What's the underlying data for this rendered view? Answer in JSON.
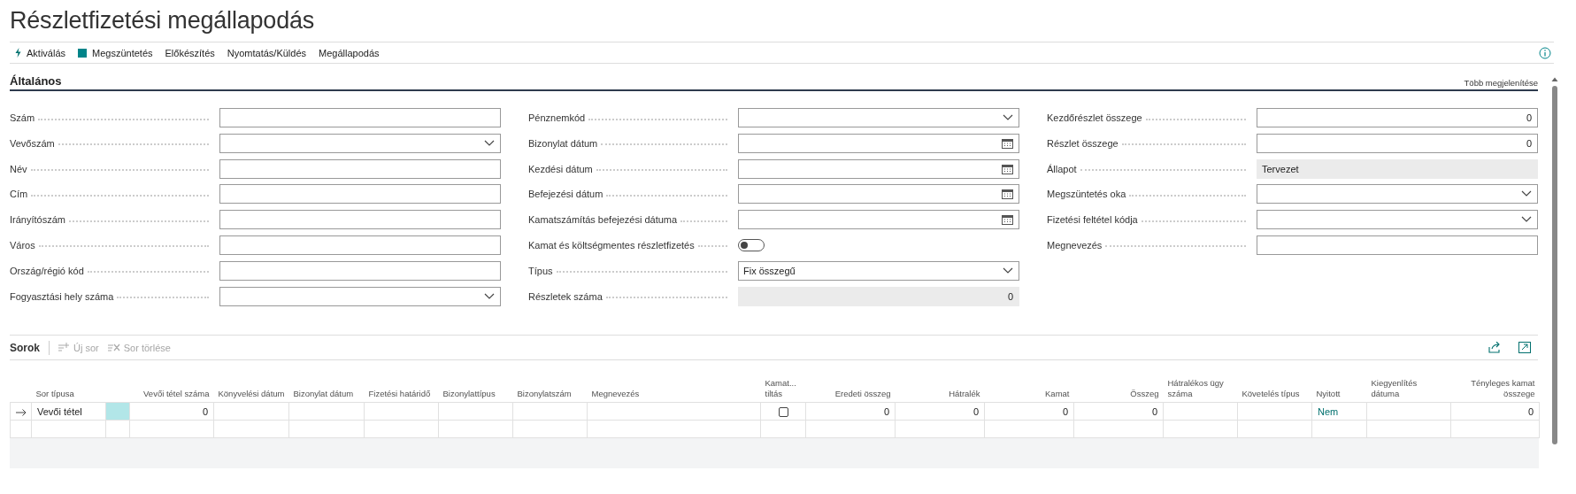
{
  "title": "Részletfizetési megállapodás",
  "actions": [
    {
      "label": "Aktiválás"
    },
    {
      "label": "Megszüntetés"
    },
    {
      "label": "Előkészítés"
    },
    {
      "label": "Nyomtatás/Küldés"
    },
    {
      "label": "Megállapodás"
    }
  ],
  "general": {
    "heading": "Általános",
    "more_link": "Több megjelenítése",
    "columns": [
      [
        {
          "label": "Szám",
          "kind": "text"
        },
        {
          "label": "Vevőszám",
          "kind": "dropdown"
        },
        {
          "label": "Név",
          "kind": "text"
        },
        {
          "label": "Cím",
          "kind": "text"
        },
        {
          "label": "Irányítószám",
          "kind": "text"
        },
        {
          "label": "Város",
          "kind": "text"
        },
        {
          "label": "Ország/régió kód",
          "kind": "text"
        },
        {
          "label": "Fogyasztási hely száma",
          "kind": "dropdown"
        }
      ],
      [
        {
          "label": "Pénznemkód",
          "kind": "dropdown"
        },
        {
          "label": "Bizonylat dátum",
          "kind": "date"
        },
        {
          "label": "Kezdési dátum",
          "kind": "date"
        },
        {
          "label": "Befejezési dátum",
          "kind": "date"
        },
        {
          "label": "Kamatszámítás befejezési dátuma",
          "kind": "date"
        },
        {
          "label": "Kamat és költségmentes részletfizetés",
          "kind": "toggle",
          "on": false
        },
        {
          "label": "Típus",
          "kind": "dropdown",
          "value": "Fix összegű"
        },
        {
          "label": "Részletek száma",
          "kind": "readonly_number",
          "value": "0"
        }
      ],
      [
        {
          "label": "Kezdőrészlet összege",
          "kind": "number",
          "value": "0"
        },
        {
          "label": "Részlet összege",
          "kind": "number",
          "value": "0"
        },
        {
          "label": "Állapot",
          "kind": "readonly",
          "value": "Tervezet"
        },
        {
          "label": "Megszüntetés oka",
          "kind": "dropdown"
        },
        {
          "label": "Fizetési feltétel kódja",
          "kind": "dropdown"
        },
        {
          "label": "Megnevezés",
          "kind": "text"
        }
      ]
    ]
  },
  "lines": {
    "heading": "Sorok",
    "actions": [
      {
        "label": "Új sor",
        "disabled": true
      },
      {
        "label": "Sor törlése",
        "disabled": true
      }
    ],
    "columns": [
      {
        "label": "Sor típusa",
        "kind": "text"
      },
      {
        "label": "Vevői tétel száma",
        "kind": "number"
      },
      {
        "label": "Könyvelési dátum",
        "kind": "text"
      },
      {
        "label": "Bizonylat dátum",
        "kind": "text"
      },
      {
        "label": "Fizetési határidő",
        "kind": "text"
      },
      {
        "label": "Bizonylattípus",
        "kind": "text"
      },
      {
        "label": "Bizonylatszám",
        "kind": "text"
      },
      {
        "label": "Megnevezés",
        "kind": "text"
      },
      {
        "label": "Kamat... tiltás",
        "kind": "check"
      },
      {
        "label": "Eredeti összeg",
        "kind": "number"
      },
      {
        "label": "Hátralék",
        "kind": "number"
      },
      {
        "label": "Kamat",
        "kind": "number"
      },
      {
        "label": "Összeg",
        "kind": "number"
      },
      {
        "label": "Hátralékos ügy száma",
        "kind": "text"
      },
      {
        "label": "Követelés típus",
        "kind": "text"
      },
      {
        "label": "Nyitott",
        "kind": "link"
      },
      {
        "label": "Kiegyenlítés dátuma",
        "kind": "text"
      },
      {
        "label": "Tényleges kamat összege",
        "kind": "number"
      }
    ],
    "rows": [
      {
        "current": true,
        "cells": [
          {
            "text": "Vevői tétel"
          },
          {
            "text": "0"
          },
          {},
          {},
          {},
          {},
          {},
          {},
          {
            "checked": false
          },
          {
            "text": "0"
          },
          {
            "text": "0"
          },
          {
            "text": "0"
          },
          {
            "text": "0"
          },
          {},
          {},
          {
            "text": "Nem"
          },
          {},
          {
            "text": "0"
          }
        ]
      },
      {
        "current": false
      }
    ]
  }
}
